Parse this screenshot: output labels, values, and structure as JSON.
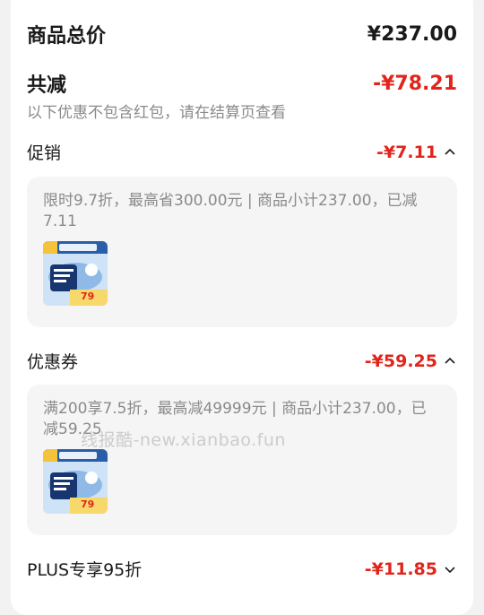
{
  "total": {
    "label": "商品总价",
    "value": "¥237.00"
  },
  "discount": {
    "label": "共减",
    "value": "-¥78.21",
    "note": "以下优惠不包含红包，请在结算页查看"
  },
  "promo": {
    "label": "促销",
    "value": "-¥7.11",
    "desc": "限时9.7折，最高省300.00元 | 商品小计237.00，已减7.11",
    "product": {
      "badge_price": "79"
    }
  },
  "coupon": {
    "label": "优惠券",
    "value": "-¥59.25",
    "desc": "满200享7.5折，最高减49999元 | 商品小计237.00，已减59.25",
    "product": {
      "badge_price": "79"
    }
  },
  "plus": {
    "label": "PLUS专享95折",
    "value": "-¥11.85"
  },
  "watermark": "线报酷-new.xianbao.fun",
  "colors": {
    "accent": "#e1251b",
    "muted": "#8a8a8a",
    "panel": "#f5f5f5"
  }
}
